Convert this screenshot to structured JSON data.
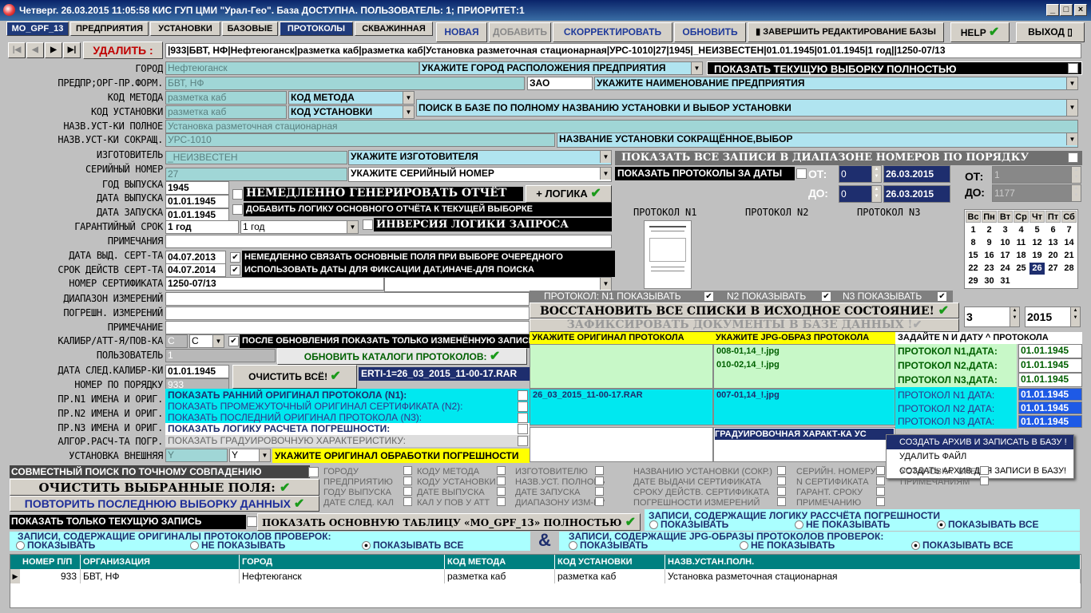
{
  "window": {
    "title": "Четверг. 26.03.2015 11:05:58 КИС ГУП ЦМИ \"Урал-Гео\". База ДОСТУПНА. ПОЛЬЗОВАТЕЛЬ: 1; ПРИОРИТЕТ:1"
  },
  "tabs": [
    "MO_GPF_13",
    "ПРЕДПРИЯТИЯ",
    "УСТАНОВКИ",
    "БАЗОВЫЕ",
    "ПРОТОКОЛЫ",
    "СКВАЖИННАЯ"
  ],
  "toolbar": {
    "new": "НОВАЯ",
    "add": "ДОБАВИТЬ",
    "edit": "СКОРРЕКТИРОВАТЬ",
    "refresh": "ОБНОВИТЬ",
    "finish": "ЗАВЕРШИТЬ РЕДАКТИРОВАНИЕ БАЗЫ",
    "help": "HELP",
    "exit": "ВЫХОД"
  },
  "nav": {
    "delete": "УДАЛИТЬ :",
    "record": "|933|БВТ, НФ|Нефтеюганск|разметка каб|разметка каб|Установка разметочная стационарная|УРС-1010|27|1945|_НЕИЗВЕСТЕН|01.01.1945|01.01.1945|1 год||1250-07/13"
  },
  "labels": [
    "ГОРОД",
    "ПРЕДПР;ОРГ-ПР.ФОРМ.",
    "КОД МЕТОДА",
    "КОД УСТАНОВКИ",
    "НАЗВ.УСТ-КИ ПОЛНОЕ",
    "НАЗВ.УСТ-КИ СОКРАЩ.",
    "ИЗГОТОВИТЕЛЬ",
    "СЕРИЙНЫЙ НОМЕР",
    "ГОД ВЫПУСКА",
    "ДАТА ВЫПУСКА",
    "ДАТА ЗАПУСКА",
    "ГАРАНТИЙНЫЙ СРОК",
    "ПРИМЕЧАНИЯ",
    "ДАТА ВЫД. СЕРТ-ТА",
    "СРОК ДЕЙСТВ СЕРТ-ТА",
    "НОМЕР СЕРТИФИКАТА",
    "ДИАПАЗОН ИЗМЕРЕНИЙ",
    "ПОГРЕШН. ИЗМЕРЕНИЙ",
    "ПРИМЕЧАНИЕ",
    "КАЛИБР/АТТ-Я/ПОВ-КА",
    "ПОЛЬЗОВАТЕЛЬ",
    "ДАТА СЛЕД.КАЛИБР-КИ",
    "НОМЕР ПО ПОРЯДКУ",
    "ПР.N1 ИМЕНА И ОРИГ.",
    "ПР.N2 ИМЕНА И ОРИГ.",
    "ПР.N3 ИМЕНА И ОРИГ.",
    "АЛГОР.РАСЧ-ТА ПОГР.",
    "УСТАНОВКА ВНЕШНЯЯ"
  ],
  "fields": {
    "city": "Нефтеюганск",
    "city_hint": "УКАЖИТЕ ГОРОД РАСПОЛОЖЕНИЯ ПРЕДПРИЯТИЯ",
    "org": "БВТ, НФ",
    "org_form": "ЗАО",
    "org_hint": "УКАЖИТЕ НАИМЕНОВАНИЕ ПРЕДПРИЯТИЯ",
    "method": "разметка каб",
    "method_dd": "КОД МЕТОДА",
    "install": "разметка каб",
    "install_dd": "КОД УСТАНОВКИ",
    "install_search": "ПОИСК В БАЗЕ ПО ПОЛНОМУ НАЗВАНИЮ УСТАНОВКИ И ВЫБОР УСТАНОВКИ",
    "full_name": "Установка разметочная стационарная",
    "short_name": "УРС-1010",
    "short_hint": "НАЗВАНИЕ УСТАНОВКИ СОКРАЩЁННОЕ,ВЫБОР",
    "maker": "_НЕИЗВЕСТЕН",
    "maker_hint": "УКАЖИТЕ ИЗГОТОВИТЕЛЯ",
    "serial": "27",
    "serial_hint": "УКАЖИТЕ СЕРИЙНЫЙ НОМЕР",
    "year": "1945",
    "release": "01.01.1945",
    "start": "01.01.1945",
    "warranty": "1 год",
    "warranty_dd": "1 год",
    "cert_issue": "04.07.2013",
    "cert_valid": "04.07.2014",
    "cert_no": "1250-07/13",
    "calib": "С",
    "calib_dd": "С",
    "user": "1",
    "next_calib": "01.01.1945",
    "order_no": "933",
    "ext": "Y",
    "ext_dd": "Y"
  },
  "options": {
    "show_all": "ПОКАЗАТЬ ТЕКУЩУЮ ВЫБОРКУ ПОЛНОСТЬЮ",
    "show_range": "ПОКАЗАТЬ ВСЕ ЗАПИСИ В ДИАПАЗОНЕ НОМЕРОВ ПО ПОРЯДКУ",
    "show_dates": "ПОКАЗАТЬ ПРОТОКОЛЫ ЗА ДАТЫ",
    "gen_report": "НЕМЕДЛЕННО ГЕНЕРИРОВАТЬ ОТЧЁТ",
    "logic": "+ ЛОГИКА",
    "add_logic": "ДОБАВИТЬ ЛОГИКУ ОСНОВНОГО ОТЧЁТА К ТЕКУЩЕЙ ВЫБОРКЕ",
    "invert": "ИНВЕРСИЯ ЛОГИКИ ЗАПРОСА",
    "link": "НЕМЕДЛЕННО СВЯЗАТЬ ОСНОВНЫЕ ПОЛЯ ПРИ ВЫБОРЕ ОЧЕРЕДНОГО",
    "use_dates": "ИСПОЛЬЗОВАТЬ ДАТЫ ДЛЯ ФИКСАЦИИ ДАТ,ИНАЧЕ-ДЛЯ ПОИСКА",
    "after_update": "ПОСЛЕ ОБНОВЛЕНИЯ ПОКАЗАТЬ ТОЛЬКО ИЗМЕНЁННУЮ ЗАПИСЬ",
    "update_catalogs": "ОБНОВИТЬ КАТАЛОГИ ПРОТОКОЛОВ:",
    "clear_all": "ОЧИСТИТЬ ВСЁ!",
    "rar": "ERTI-1=26_03_2015_11-00-17.RAR"
  },
  "dates": {
    "from_label": "ОТ:",
    "to_label": "ДО:",
    "from_n": "0",
    "to_n": "0",
    "from_d": "26.03.2015",
    "to_d": "26.03.2015",
    "from2": "1",
    "to2": "1177"
  },
  "protocols": {
    "p1": "ПРОТОКОЛ N1",
    "p2": "ПРОТОКОЛ N2",
    "p3": "ПРОТОКОЛ N3",
    "show_line": "ПРОТОКОЛ: N1 ПОКАЗЫВАТЬ",
    "show2": "N2 ПОКАЗЫВАТЬ",
    "show3": "N3 ПОКАЗЫВАТЬ",
    "restore": "ВОССТАНОВИТЬ ВСЕ СПИСКИ В ИСХОДНОЕ СОСТОЯНИЕ!",
    "fix": "ЗАФИКСИРОВАТЬ ДОКУМЕНТЫ В БАЗЕ ДАННЫХ",
    "orig_hdr": "УКАЖИТЕ ОРИГИНАЛ ПРОТОКОЛА",
    "jpg_hdr": "УКАЖИТЕ JPG-ОБРАЗ ПРОТОКОЛА",
    "date_hdr": "ЗАДАЙТЕ N И ДАТУ ^ ПРОТОКОЛА",
    "jpg1": "008-01,14_!.jpg",
    "jpg2": "010-02,14_!.jpg",
    "rarfile": "26_03_2015_11-00-17.RAR",
    "jpg3": "007-01,14_!.jpg",
    "grad": "ГРАДУИРОВОЧНАЯ ХАРАКТ-КА УС",
    "p1d": "ПРОТОКОЛ N1,ДАТА:",
    "p2d": "ПРОТОКОЛ N2,ДАТА:",
    "p3d": "ПРОТОКОЛ N3,ДАТА:",
    "d1": "01.01.1945",
    "d2": "01.01.1945",
    "d3": "01.01.1945",
    "p1d2": "ПРОТОКОЛ N1 ДАТА:",
    "p2d2": "ПРОТОКОЛ N2 ДАТА:",
    "p3d2": "ПРОТОКОЛ N3 ДАТА:",
    "e1": "01.01.1945",
    "e2": "01.01.1945",
    "e3": "01.01.1945"
  },
  "show": {
    "early": "ПОКАЗАТЬ РАННИЙ ОРИГИНАЛ ПРОТОКОЛА (N1):",
    "mid": "ПОКАЗАТЬ ПРОМЕЖУТОЧНЫЙ ОРИГИНАЛ СЕРТИФИКАТА (N2):",
    "last": "ПОКАЗАТЬ ПОСЛЕДНИЙ ОРИГИНАЛ ПРОТОКОЛА (N3):",
    "logic": "ПОКАЗАТЬ ЛОГИКУ РАСЧЕТА ПОГРЕШНОСТИ:",
    "grad": "ПОКАЗАТЬ ГРАДУИРОВОЧНУЮ ХАРАКТЕРИСТИКУ:",
    "orig_err": "УКАЖИТЕ ОРИГИНАЛ ОБРАБОТКИ ПОГРЕШНОСТИ"
  },
  "menu": [
    "СОЗДАТЬ АРХИВ И ЗАПИСАТЬ В БАЗУ !",
    "УДАЛИТЬ ФАЙЛ",
    "СОЗДАТЬ АРХИВ ДЛЯ ЗАПИСИ В БАЗУ!"
  ],
  "calendar": {
    "days": [
      "Вс",
      "Пн",
      "Вт",
      "Ср",
      "Чт",
      "Пт",
      "Сб"
    ],
    "rows": [
      [
        "1",
        "2",
        "3",
        "4",
        "5",
        "6",
        "7"
      ],
      [
        "8",
        "9",
        "10",
        "11",
        "12",
        "13",
        "14"
      ],
      [
        "15",
        "16",
        "17",
        "18",
        "19",
        "20",
        "21"
      ],
      [
        "22",
        "23",
        "24",
        "25",
        "26",
        "27",
        "28"
      ],
      [
        "29",
        "30",
        "31",
        "",
        "",
        "",
        ""
      ]
    ],
    "selected": "26",
    "month": "3",
    "year": "2015"
  },
  "bottom": {
    "joint": "СОВМЕСТНЫЙ ПОИСК ПО ТОЧНОМУ СОВПАДЕНИЮ",
    "clear_fields": "ОЧИСТИТЬ ВЫБРАННЫЕ ПОЛЯ:",
    "repeat": "ПОВТОРИТЬ ПОСЛЕДНЮЮ ВЫБОРКУ ДАННЫХ",
    "current_only": "ПОКАЗАТЬ ТОЛЬКО ТЕКУЩУЮ ЗАПИСЬ",
    "main_table": "ПОКАЗАТЬ ОСНОВНУЮ ТАБЛИЦУ «MO_GPF_13» ПОЛНОСТЬЮ",
    "logic_records": "ЗАПИСИ, СОДЕРЖАЩИЕ ЛОГИКУ  РАССЧЁТА ПОГРЕШНОСТИ",
    "orig_records": "ЗАПИСИ, СОДЕРЖАЩИЕ ОРИГИНАЛЫ ПРОТОКОЛОВ ПРОВЕРОК:",
    "jpg_records": "ЗАПИСИ, СОДЕРЖАЩИЕ JPG-ОБРАЗЫ ПРОТОКОЛОВ ПРОВЕРОК:",
    "r_show": "ПОКАЗЫВАТЬ",
    "r_noshow": "НЕ ПОКАЗЫВАТЬ",
    "r_all": "ПОКАЗЫВАТЬ ВСЕ",
    "amp": "&"
  },
  "filters": [
    "ГОРОДУ",
    "ПРЕДПРИЯТИЮ",
    "ГОДУ ВЫПУСКА",
    "ДАТЕ СЛЕД. КАЛ",
    "КОДУ МЕТОДА",
    "КОДУ УСТАНОВКИ",
    "ДАТЕ ВЫПУСКА",
    "КАЛ У ПОВ У АТТ",
    "ИЗГОТОВИТЕЛЮ",
    "НАЗВ.УСТ. ПОЛНОМУ",
    "ДАТЕ ЗАПУСКА",
    "ДИАПАЗОНУ ИЗМ-НИЙ",
    "НАЗВАНИЮ УСТАНОВКИ (СОКР.)",
    "ДАТЕ ВЫДАЧИ СЕРТИФИКАТА",
    "СРОКУ ДЕЙСТВ. СЕРТИФИКАТА",
    "ПОГРЕШНОСТИ ИЗМЕРЕНИЙ",
    "СЕРИЙН. НОМЕРУ",
    "N СЕРТИФИКАТА",
    "ГАРАНТ. СРОКУ",
    "ПРИМЕЧАНИЮ",
    "УСТАНОВКА \"ВНЕШНЯЯ\" ?",
    "ПРИМЕЧАНИЯМ"
  ],
  "grid": {
    "headers": [
      "НОМЕР П/П",
      "ОРГАНИЗАЦИЯ",
      "ГОРОД",
      "КОД МЕТОДА",
      "КОД УСТАНОВКИ",
      "НАЗВ.УСТАН.ПОЛН."
    ],
    "row": [
      "933",
      "БВТ, НФ",
      "Нефтеюганск",
      "разметка каб",
      "разметка каб",
      "Установка разметочная стационарная"
    ]
  }
}
